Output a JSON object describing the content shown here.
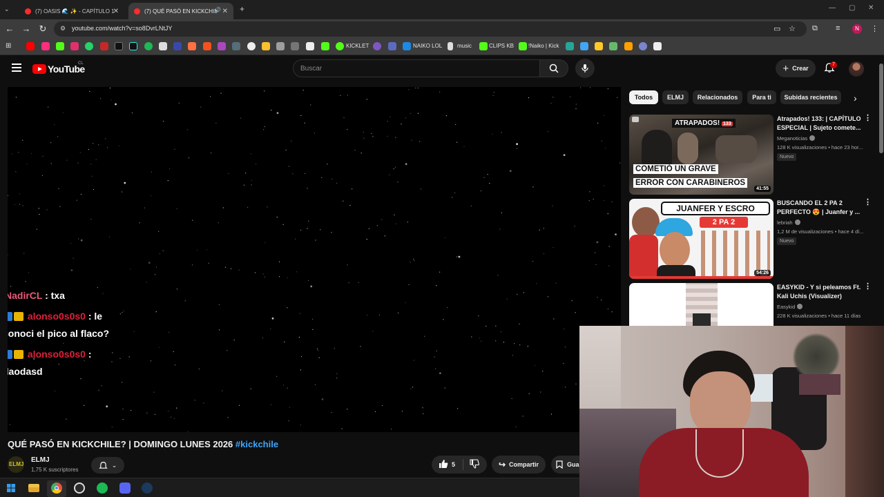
{
  "browser": {
    "tabs": [
      {
        "label": "(7) OASIS 🌊 ✨ - CAPÍTULO 1",
        "close": "✕"
      },
      {
        "label": "(7) QUÉ PASÓ EN KICKCHIL",
        "close": "✕"
      }
    ],
    "new_tab": "+",
    "url": "youtube.com/watch?v=so8DvrLNtJY",
    "profile_initial": "N",
    "bookmarks": [
      "KICKLET",
      "NAIKO LOL",
      "music",
      "CLIPS KB",
      "!Naiko | Kick"
    ]
  },
  "youtube": {
    "logo_text": "YouTube",
    "country": "CL",
    "search_placeholder": "Buscar",
    "create_label": "Crear",
    "notification_count": "7"
  },
  "player": {
    "chat": [
      {
        "user": "NadirCL",
        "text": ": txa"
      },
      {
        "user": "alonso0s0s0",
        "text": ": le",
        "text2": "conoci el pico al flaco?"
      },
      {
        "user": "alonso0s0s0",
        "text": ":",
        "text2": "daodasd"
      }
    ]
  },
  "video": {
    "title": "QUÉ PASÓ EN KICKCHILE? | DOMINGO LUNES 2026",
    "hashtag": "#kickchile",
    "channel": "ELMJ",
    "avatar_text": "ELMJ",
    "subscribers": "1,75 K suscriptores",
    "likes": "5",
    "share_label": "Compartir",
    "save_label": "Gua"
  },
  "sidebar": {
    "chips": [
      "Todos",
      "ELMJ",
      "Relacionados",
      "Para ti",
      "Subidas recientes"
    ],
    "recommendations": [
      {
        "title": "Atrapados! 133: | CAPÍTULO ESPECIAL | Sujeto comete...",
        "channel": "Meganoticias",
        "meta": "128 K visualizaciones • hace 23 hor...",
        "badge": "Nuevo",
        "duration": "41:55",
        "thumb_top": "ATRAPADOS!",
        "thumb_num": "133",
        "thumb_line1": "COMETIÓ UN GRAVE",
        "thumb_line2": "ERROR CON CARABINEROS"
      },
      {
        "title": "BUSCANDO EL 2 PA 2 PERFECTO 😍 | Juanfer y ...",
        "channel": "lebriah",
        "meta": "1,2 M de visualizaciones • hace 4 dí...",
        "badge": "Nuevo",
        "duration": "54:26",
        "thumb_top": "JUANFER Y ESCRO",
        "thumb_sub": "2 PA 2"
      },
      {
        "title": "EASYKID - Y si peleamos Ft. Kali Uchis (Visualizer)",
        "channel": "Easykid",
        "meta": "228 K visualizaciones • hace 11 días"
      }
    ]
  },
  "colors": {
    "accent": "#ff0000",
    "hashtag": "#3ea6ff",
    "chat_user_pink": "#e85a77",
    "chat_user_red": "#e0203a"
  }
}
